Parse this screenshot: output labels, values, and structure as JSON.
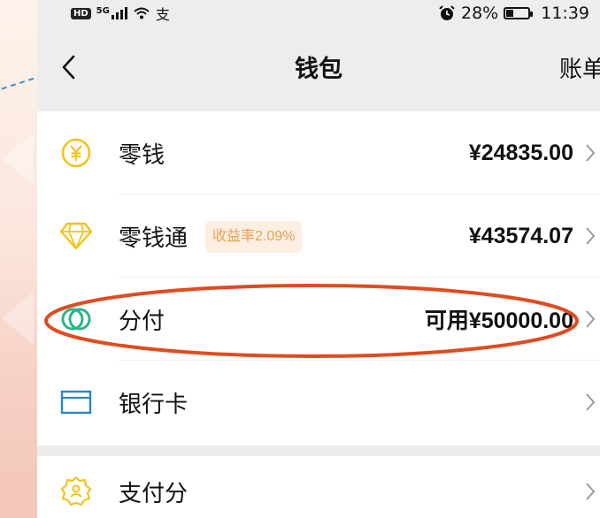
{
  "status_bar": {
    "hd_label": "HD",
    "network": "5G",
    "extra_glyph": "支",
    "battery_percent": "28%",
    "battery_level": 0.28,
    "time": "11:39"
  },
  "nav": {
    "title": "钱包",
    "right_label": "账单",
    "back_icon": "chevron-left-icon"
  },
  "wallet_items": [
    {
      "label": "零钱",
      "value": "¥24835.00",
      "icon": "yuan-coin-icon",
      "badge": ""
    },
    {
      "label": "零钱通",
      "value": "¥43574.07",
      "icon": "diamond-icon",
      "badge": "收益率2.09%"
    },
    {
      "label": "分付",
      "value": "可用¥50000.00",
      "icon": "fenfu-icon",
      "badge": ""
    },
    {
      "label": "银行卡",
      "value": "",
      "icon": "bank-card-icon",
      "badge": ""
    }
  ],
  "second_items": [
    {
      "label": "支付分",
      "value": "",
      "icon": "pay-score-icon"
    }
  ],
  "colors": {
    "accent_yellow": "#f2c41a",
    "bank_card_blue": "#2a86c8",
    "fenfu_green": "#2bb58a",
    "annotation_red": "#e04b1f",
    "badge_bg": "#fcefe2",
    "badge_text": "#e3a155"
  }
}
